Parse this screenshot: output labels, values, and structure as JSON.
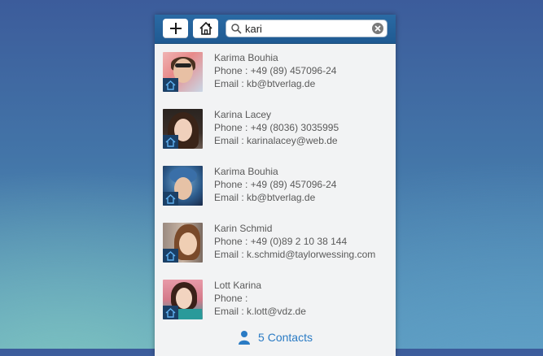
{
  "search": {
    "value": "kari"
  },
  "contacts": [
    {
      "name": "Karima Bouhia",
      "phone": "Phone : +49 (89) 457096-24",
      "email": "Email : kb@btverlag.de"
    },
    {
      "name": "Karina Lacey",
      "phone": "Phone : +49 (8036) 3035995",
      "email": "Email : karinalacey@web.de"
    },
    {
      "name": "Karima Bouhia",
      "phone": "Phone : +49 (89) 457096-24",
      "email": "Email : kb@btverlag.de"
    },
    {
      "name": "Karin Schmid",
      "phone": "Phone : +49 (0)89 2 10 38 144",
      "email": "Email : k.schmid@taylorwessing.com"
    },
    {
      "name": "Lott Karina",
      "phone": "Phone :",
      "email": "Email : k.lott@vdz.de"
    }
  ],
  "footer": {
    "count_label": "5 Contacts"
  },
  "icons": {
    "add": "plus-icon",
    "home": "house-icon",
    "search": "magnifier-icon",
    "clear": "clear-icon",
    "badge": "house-badge-icon",
    "person": "person-icon"
  },
  "colors": {
    "toolbar": "#1f5a92",
    "accent": "#2a7bc4",
    "badge": "#1a3f66"
  }
}
